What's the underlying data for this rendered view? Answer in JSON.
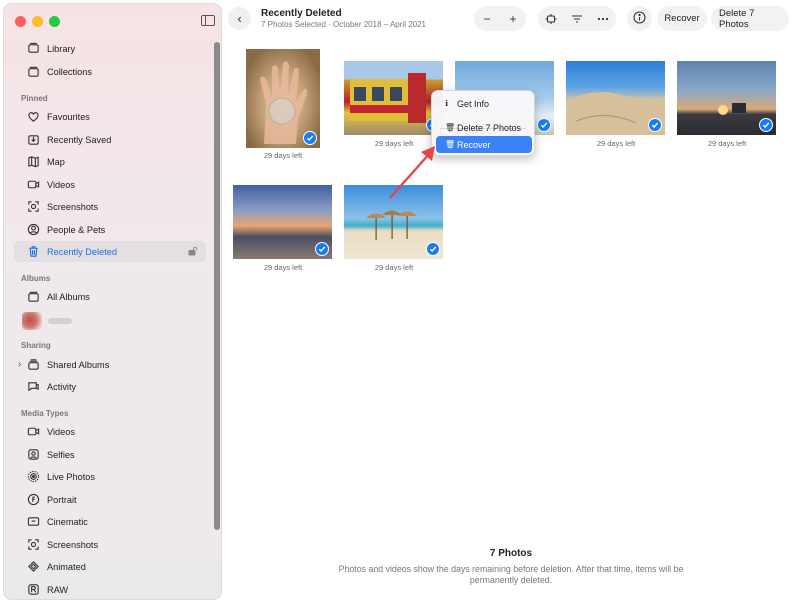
{
  "window": {
    "title": "Recently Deleted",
    "subtitle": "7 Photos Selected · October 2018 – April 2021"
  },
  "toolbar": {
    "zoom_out": "−",
    "zoom_in": "+",
    "recover_label": "Recover",
    "delete_label": "Delete 7 Photos"
  },
  "sidebar": {
    "top": [
      {
        "label": "Library",
        "icon": "library-icon"
      },
      {
        "label": "Collections",
        "icon": "collections-icon"
      }
    ],
    "pinned_heading": "Pinned",
    "pinned": [
      {
        "label": "Favourites",
        "icon": "heart-icon"
      },
      {
        "label": "Recently Saved",
        "icon": "download-icon"
      },
      {
        "label": "Map",
        "icon": "map-icon"
      },
      {
        "label": "Videos",
        "icon": "video-icon"
      },
      {
        "label": "Screenshots",
        "icon": "screenshot-icon"
      },
      {
        "label": "People & Pets",
        "icon": "person-icon"
      },
      {
        "label": "Recently Deleted",
        "icon": "trash-icon",
        "active": true
      }
    ],
    "albums_heading": "Albums",
    "albums": [
      {
        "label": "All Albums",
        "icon": "albums-icon"
      }
    ],
    "sharing_heading": "Sharing",
    "sharing": [
      {
        "label": "Shared Albums",
        "icon": "shared-albums-icon"
      },
      {
        "label": "Activity",
        "icon": "activity-icon"
      }
    ],
    "media_heading": "Media Types",
    "media": [
      {
        "label": "Videos",
        "icon": "video-icon"
      },
      {
        "label": "Selfies",
        "icon": "selfie-icon"
      },
      {
        "label": "Live Photos",
        "icon": "live-photo-icon"
      },
      {
        "label": "Portrait",
        "icon": "portrait-icon"
      },
      {
        "label": "Cinematic",
        "icon": "cinematic-icon"
      },
      {
        "label": "Screenshots",
        "icon": "screenshot-icon"
      },
      {
        "label": "Animated",
        "icon": "animated-icon"
      },
      {
        "label": "RAW",
        "icon": "raw-icon"
      }
    ]
  },
  "photos": [
    {
      "days": "29 days left",
      "image": "open palm holding a clear jelly disc"
    },
    {
      "days": "29 days left",
      "image": "colourful old building facade"
    },
    {
      "days": "29 days left",
      "image": "blue sky with light clouds"
    },
    {
      "days": "29 days left",
      "image": "sand dune under blue sky"
    },
    {
      "days": "29 days left",
      "image": "sunset over a coastline"
    },
    {
      "days": "29 days left",
      "image": "sunset over the sea"
    },
    {
      "days": "29 days left",
      "image": "beach with thatched umbrellas"
    }
  ],
  "context_menu": {
    "get_info": "Get Info",
    "delete": "Delete 7 Photos",
    "recover": "Recover"
  },
  "footer": {
    "count": "7 Photos",
    "note": "Photos and videos show the days remaining before deletion. After that time, items will be permanently deleted."
  },
  "colors": {
    "accent": "#1a7cf5",
    "menu_highlight": "#3b82f6",
    "annotation_arrow": "#e8424a"
  }
}
